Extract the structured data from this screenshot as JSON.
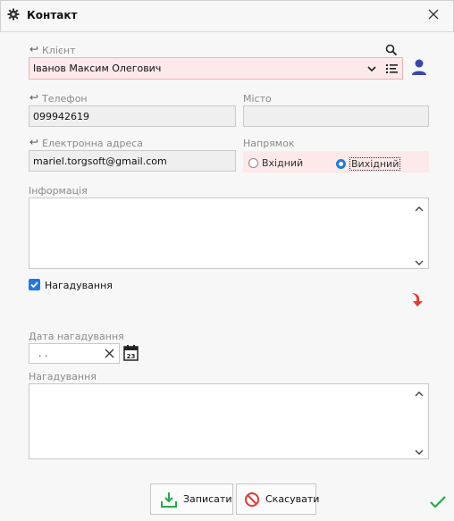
{
  "window": {
    "title": "Контакт"
  },
  "client": {
    "label": "Клієнт",
    "value": "Іванов Максим Олегович"
  },
  "phone": {
    "label": "Телефон",
    "value": "099942619"
  },
  "city": {
    "label": "Місто",
    "value": ""
  },
  "email": {
    "label": "Електронна адреса",
    "value": "mariel.torgsoft@gmail.com"
  },
  "direction": {
    "label": "Напрямок",
    "options": [
      "Вхідний",
      "Вихідний"
    ],
    "selected": "Вихідний"
  },
  "info": {
    "label": "Інформація",
    "value": ""
  },
  "reminder_checkbox": {
    "label": "Нагадування",
    "checked": true
  },
  "reminder_date": {
    "label": "Дата нагадування",
    "value": ". ."
  },
  "reminder_text": {
    "label": "Нагадування",
    "value": ""
  },
  "buttons": {
    "save": "Записати",
    "cancel": "Скасувати"
  },
  "colors": {
    "accent": "#1f7ae0",
    "required_bg": "#fde9e9",
    "success": "#2aa84a",
    "arrow": "#e53935"
  }
}
